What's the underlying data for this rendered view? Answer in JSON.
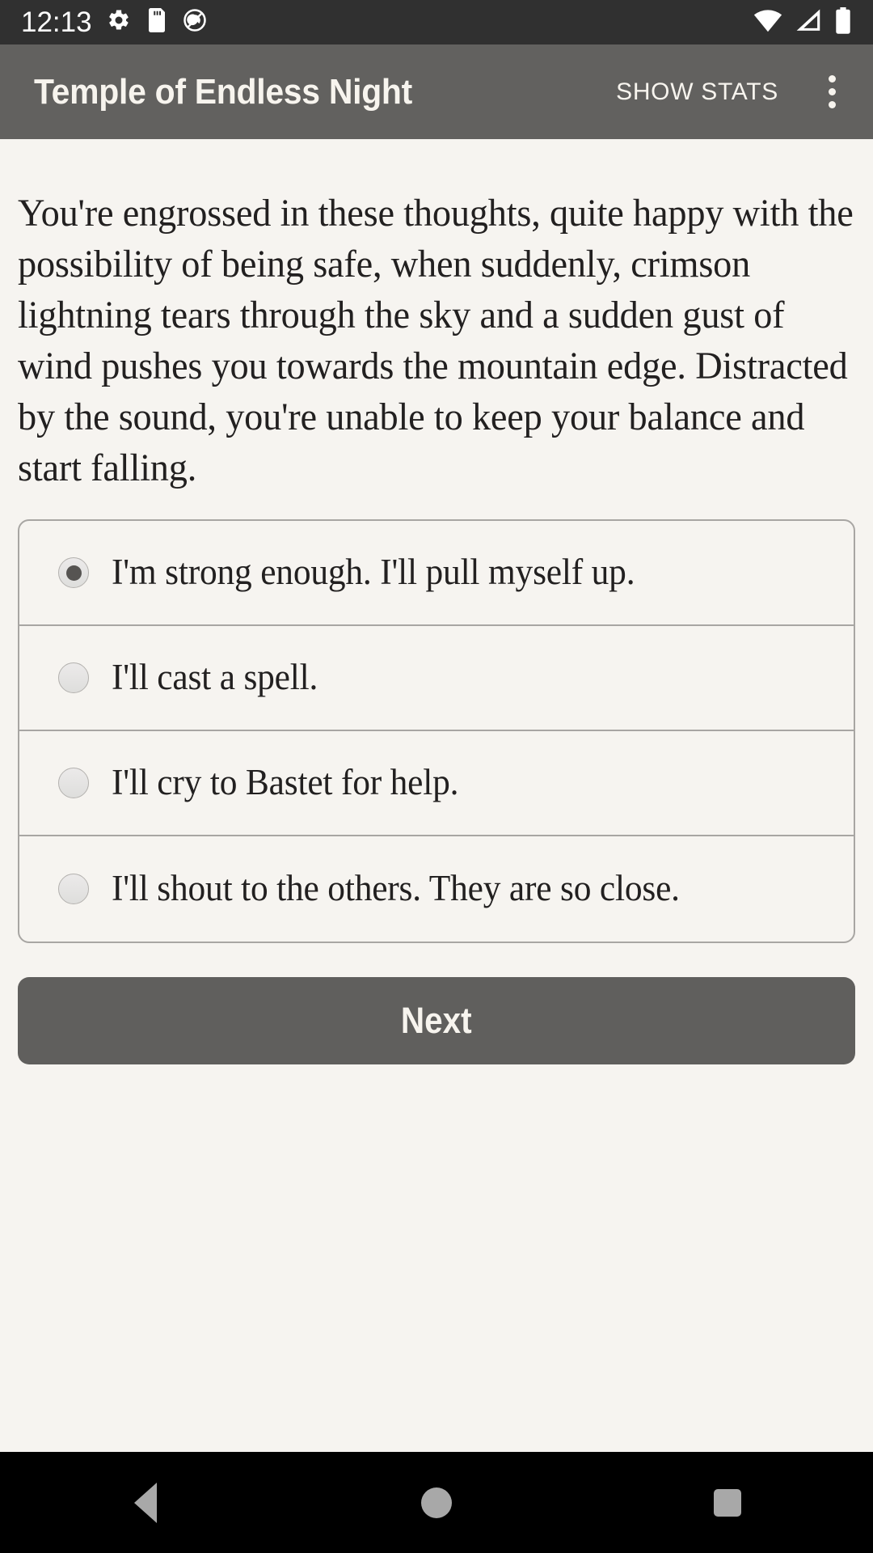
{
  "status_bar": {
    "clock": "12:13",
    "icons": [
      "gear-icon",
      "sd-card-icon",
      "do-not-disturb-icon"
    ],
    "right_icons": [
      "wifi-icon",
      "cellular-signal-icon",
      "battery-icon"
    ]
  },
  "app_bar": {
    "title": "Temple of Endless Night",
    "show_stats_label": "SHOW STATS",
    "overflow_icon": "more-vert-icon",
    "background_color": "#62615f",
    "text_color": "#f7f4ee"
  },
  "story": {
    "text": "You're engrossed in these thoughts, quite happy with the possibility of being safe, when suddenly, crimson lightning tears through the sky and a sudden gust of wind pushes you towards the mountain edge. Distracted by the sound, you're unable to keep your balance and start falling."
  },
  "options": {
    "selected_index": 0,
    "items": [
      {
        "label": "I'm strong enough. I'll pull myself up.",
        "selected": true
      },
      {
        "label": "I'll cast a spell.",
        "selected": false
      },
      {
        "label": "I'll cry to Bastet for help.",
        "selected": false
      },
      {
        "label": "I'll shout to the others. They are so close.",
        "selected": false
      }
    ]
  },
  "next_button": {
    "label": "Next",
    "background_color": "#605f5d"
  },
  "nav_bar": {
    "back": "back-icon",
    "home": "home-icon",
    "recents": "recents-icon"
  },
  "colors": {
    "page_background": "#f6f4f0",
    "body_text": "#222020",
    "card_border": "#a8a6a3",
    "status_bar": "#303030"
  }
}
